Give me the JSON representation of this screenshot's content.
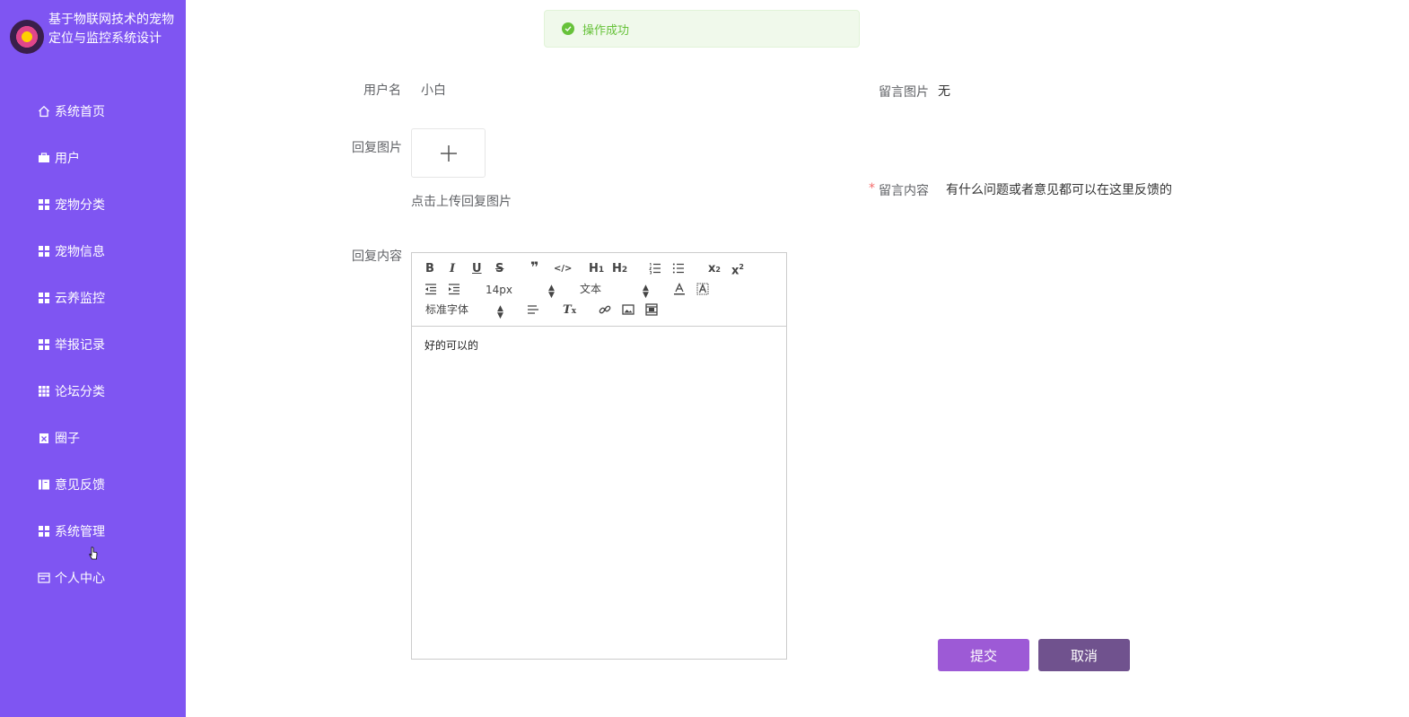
{
  "app": {
    "title": "基于物联网技术的宠物定位与监控系统设计"
  },
  "sidebar": {
    "items": [
      {
        "label": "系统首页",
        "icon": "home-icon"
      },
      {
        "label": "用户",
        "icon": "briefcase-icon"
      },
      {
        "label": "宠物分类",
        "icon": "grid-icon"
      },
      {
        "label": "宠物信息",
        "icon": "grid-icon"
      },
      {
        "label": "云养监控",
        "icon": "grid-icon"
      },
      {
        "label": "举报记录",
        "icon": "grid-icon"
      },
      {
        "label": "论坛分类",
        "icon": "table-icon"
      },
      {
        "label": "圈子",
        "icon": "clipboard-icon"
      },
      {
        "label": "意见反馈",
        "icon": "book-icon"
      },
      {
        "label": "系统管理",
        "icon": "grid-icon"
      },
      {
        "label": "个人中心",
        "icon": "id-card-icon"
      }
    ]
  },
  "toast": {
    "message": "操作成功",
    "color": "#67c23a"
  },
  "form": {
    "username_label": "用户名",
    "username_value": "小白",
    "message_image_label": "留言图片",
    "message_image_value": "无",
    "reply_image_label": "回复图片",
    "upload_hint": "点击上传回复图片",
    "message_content_required": "*",
    "message_content_label": "留言内容",
    "message_content_value": "有什么问题或者意见都可以在这里反馈的",
    "reply_content_label": "回复内容"
  },
  "editor": {
    "font_size": "14px",
    "paragraph": "文本",
    "font_family": "标准字体",
    "content": "好的可以的",
    "toolbar_icons": [
      "bold-icon",
      "italic-icon",
      "underline-icon",
      "strikethrough-icon",
      "blockquote-icon",
      "code-block-icon",
      "h1-icon",
      "h2-icon",
      "ordered-list-icon",
      "bullet-list-icon",
      "subscript-icon",
      "superscript-icon",
      "outdent-icon",
      "indent-icon",
      "font-color-icon",
      "background-color-icon",
      "align-icon",
      "clear-format-icon",
      "link-icon",
      "image-icon",
      "video-icon"
    ]
  },
  "actions": {
    "submit": "提交",
    "cancel": "取消",
    "submit_color": "#9d5ad6",
    "cancel_color": "#70528e"
  },
  "theme": {
    "sidebar_bg": "#7f55f2"
  }
}
